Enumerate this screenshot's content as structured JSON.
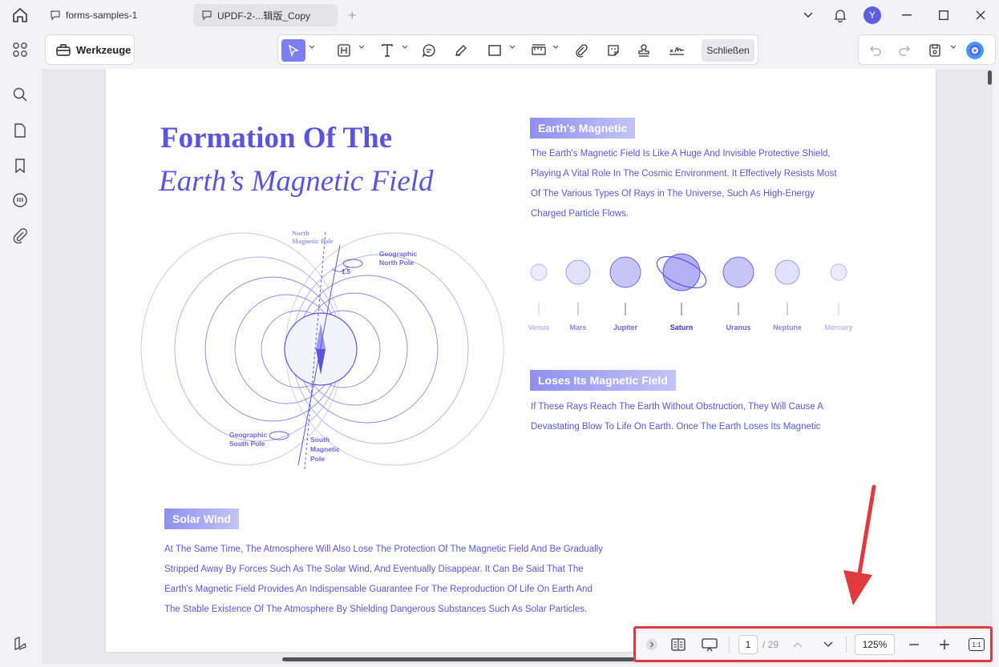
{
  "tabs": [
    {
      "label": "forms-samples-1"
    },
    {
      "label": "UPDF-2-...辑版_Copy"
    }
  ],
  "user": {
    "initial": "Y"
  },
  "toolbar": {
    "werkzeuge_label": "Werkzeuge",
    "close_label": "Schließen"
  },
  "document": {
    "title_line1": "Formation Of The",
    "title_line2": "Earth’s Magnetic Field",
    "diagram_labels": {
      "north_magnetic_pole": [
        "North",
        "Magnetic Pole"
      ],
      "geographic_north_pole": [
        "Geographic",
        "North Pole"
      ],
      "angle": "1.5",
      "geographic_south_pole": [
        "Geographic",
        "South Pole"
      ],
      "south_magnetic_pole": [
        "South",
        "Magnetic",
        "Pole"
      ]
    },
    "section1": {
      "heading": "Earth's Magnetic",
      "lines": [
        "The Earth's Magnetic Field Is Like A Huge And Invisible Protective Shield,",
        "Playing A Vital Role In The Cosmic Environment. It Effectively Resists Most",
        "Of The Various Types Of Rays in The Universe, Such As High-Energy",
        "Charged Particle Flows."
      ]
    },
    "planets": [
      "Venus",
      "Mars",
      "Jupiter",
      "Saturn",
      "Uranus",
      "Neptune",
      "Mercury"
    ],
    "section2": {
      "heading": "Loses Its Magnetic Field",
      "lines": [
        "If These Rays Reach The Earth Without Obstruction, They Will Cause A",
        "Devastating Blow To Life On Earth. Once The Earth Loses Its Magnetic"
      ]
    },
    "section3": {
      "heading": "Solar Wind",
      "lines": [
        "At The Same Time, The Atmosphere Will Also Lose The Protection Of The Magnetic Field And Be Gradually",
        "Stripped Away By Forces Such As The Solar Wind, And Eventually Disappear. It Can Be Said That The",
        "Earth's Magnetic Field Provides An Indispensable Guarantee For The Reproduction Of Life On Earth And",
        "The Stable Existence Of The Atmosphere By Shielding Dangerous Substances Such As Solar Particles."
      ]
    }
  },
  "navigation": {
    "current_page": "1",
    "total_pages": "/ 29",
    "zoom": "125%",
    "fit_label": "1:1"
  },
  "colors": {
    "accent": "#5b54e0",
    "highlight": "#e0393e"
  }
}
